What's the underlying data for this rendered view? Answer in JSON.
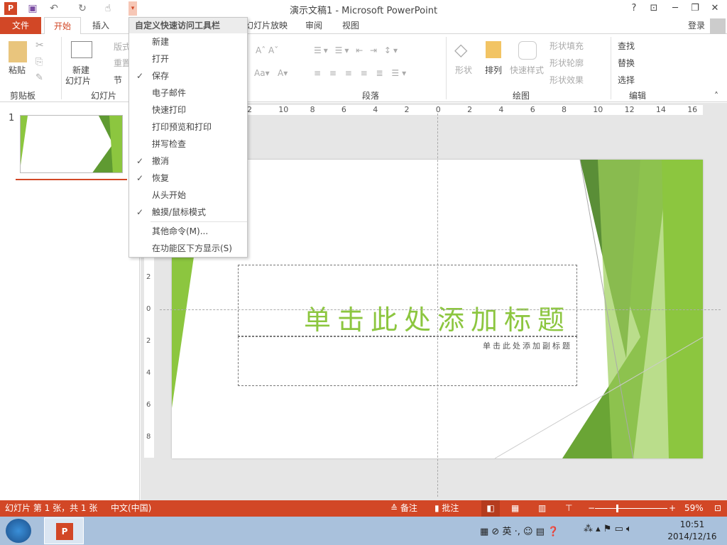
{
  "window": {
    "title": "演示文稿1 - Microsoft PowerPoint",
    "help": "?",
    "login": "登录"
  },
  "tabs": [
    "文件",
    "开始",
    "插入",
    "幻灯片放映",
    "审阅",
    "视图"
  ],
  "ribbon": {
    "paste": "粘贴",
    "clipboard_group": "剪贴板",
    "new_slide_1": "新建",
    "new_slide_2": "幻灯片",
    "layout": "版式",
    "reset": "重置",
    "section": "节",
    "slides_group": "幻灯片",
    "paragraph_group": "段落",
    "shape": "形状",
    "arrange": "排列",
    "quick_styles": "快速样式",
    "shape_fill": "形状填充",
    "shape_outline": "形状轮廓",
    "shape_effects": "形状效果",
    "drawing_group": "绘图",
    "find": "查找",
    "replace": "替换",
    "select": "选择",
    "editing_group": "编辑"
  },
  "qat_menu": {
    "header": "自定义快速访问工具栏",
    "items": [
      {
        "label": "新建",
        "checked": false
      },
      {
        "label": "打开",
        "checked": false
      },
      {
        "label": "保存",
        "checked": true
      },
      {
        "label": "电子邮件",
        "checked": false
      },
      {
        "label": "快速打印",
        "checked": false
      },
      {
        "label": "打印预览和打印",
        "checked": false
      },
      {
        "label": "拼写检查",
        "checked": false
      },
      {
        "label": "撤消",
        "checked": true
      },
      {
        "label": "恢复",
        "checked": true
      },
      {
        "label": "从头开始",
        "checked": false
      },
      {
        "label": "触摸/鼠标模式",
        "checked": true
      }
    ],
    "more": "其他命令(M)...",
    "show_below": "在功能区下方显示(S)",
    "check": "✓"
  },
  "thumbnail": {
    "number": "1"
  },
  "ruler": {
    "h": [
      "2",
      "10",
      "8",
      "6",
      "4",
      "2",
      "0",
      "2",
      "4",
      "6",
      "8",
      "10",
      "12",
      "14",
      "16"
    ],
    "v": [
      "2",
      "0",
      "2",
      "4",
      "6",
      "8"
    ]
  },
  "slide": {
    "title": "单击此处添加标题",
    "subtitle": "单击此处添加副标题"
  },
  "status": {
    "slide_info": "幻灯片 第 1 张，共 1 张",
    "language": "中文(中国)",
    "notes": "备注",
    "comments": "批注",
    "zoom": "59%",
    "zoom_value": 59
  },
  "taskbar": {
    "time": "10:51",
    "date": "2014/12/16",
    "ime": "英"
  },
  "colors": {
    "accent": "#d24726",
    "green": "#8cc63f"
  }
}
